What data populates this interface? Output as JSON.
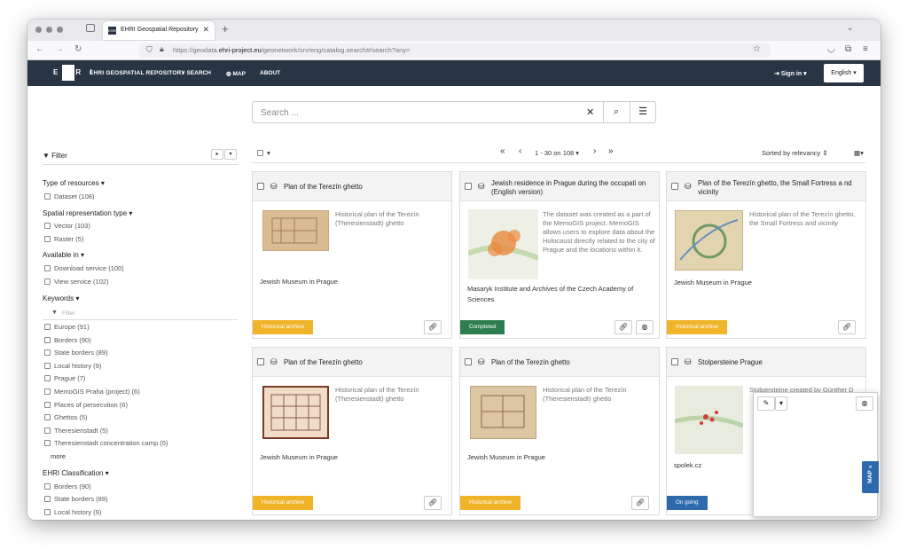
{
  "browser": {
    "tab_title": "EHRI Geospatial Repository",
    "favicon_text": "EHRI",
    "url_prefix": "https://geodata.",
    "url_domain": "ehri-project.eu",
    "url_suffix": "/geonetwork/srv/eng/catalog.search#/search?any="
  },
  "nav": {
    "logo_left": "E",
    "logo_right": "R I",
    "brand": "EHRI GEOSPATIAL REPOSITORY",
    "search": "SEARCH",
    "map": "MAP",
    "about": "ABOUT",
    "signin": "Sign in",
    "language": "English"
  },
  "search": {
    "placeholder": "Search ..."
  },
  "filter": {
    "title": "Filter",
    "sections": [
      {
        "title": "Type of resources",
        "options": [
          "Dataset (108)"
        ]
      },
      {
        "title": "Spatial representation type",
        "options": [
          "Vector (103)",
          "Raster (5)"
        ]
      },
      {
        "title": "Available in",
        "options": [
          "Download service (100)",
          "View service (102)"
        ]
      },
      {
        "title": "Keywords",
        "options": [
          "Europe (91)",
          "Borders (90)",
          "State borders (89)",
          "Local history (9)",
          "Prague (7)",
          "MemoGIS Praha (project) (6)",
          "Places of persecution (6)",
          "Ghettos (5)",
          "Theresienstadt (5)",
          "Theresienstadt concentration camp (5)"
        ]
      },
      {
        "title": "EHRI Classification",
        "options": [
          "Borders (90)",
          "State borders (89)",
          "Local history (9)"
        ]
      }
    ],
    "keyword_filter_placeholder": "Filter",
    "more": "more"
  },
  "toolbar": {
    "pagination": "1 - 30 on 108",
    "sort": "Sorted by relevancy"
  },
  "results": [
    {
      "title": "Plan of the Terezín ghetto",
      "desc": "Historical plan of the Terezín (Theresienstadt) ghetto",
      "org": "Jewish Museum in Prague",
      "badge": "Historical archive"
    },
    {
      "title": "Jewish residence in Prague during the occupati on (English version)",
      "desc": "The dataset was created as a part of the MemoGIS project. MemoGIS allows users to explore data about the Holocaust directly related to the city of Prague and the locations within it.",
      "org": "Masaryk Institute and Archives of the Czech Academy of Sciences",
      "badge": "Completed"
    },
    {
      "title": "Plan of the Terezín ghetto, the Small Fortress a nd vicinity",
      "desc": "Historical plan of the Terezín ghetto, the Small Fortress and vicinity",
      "org": "Jewish Museum in Prague",
      "badge": "Historical archive"
    },
    {
      "title": "Plan of the Terezín ghetto",
      "desc": "Historical plan of the Terezín (Theresienstadt) ghetto",
      "org": "Jewish Museum in Prague",
      "badge": "Historical archive"
    },
    {
      "title": "Plan of the Terezín ghetto",
      "desc": "Historical plan of the Terezín (Theresienstadt) ghetto",
      "org": "Jewish Museum in Prague",
      "badge": "Historical archive"
    },
    {
      "title": "Stolpersteine Prague",
      "desc": "Stolpersteine created by Günther D",
      "org": "spolek.cz",
      "badge": "On going"
    }
  ],
  "map_toggle": "MAP",
  "colors": {
    "nav_bg": "#293545",
    "historical": "#f0b429",
    "completed": "#2e7d4f",
    "ongoing": "#2d6aad"
  }
}
